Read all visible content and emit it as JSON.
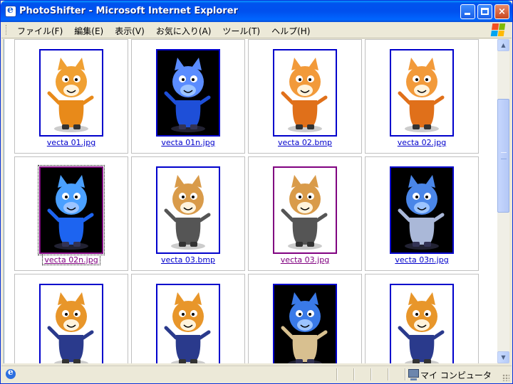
{
  "window": {
    "title": "PhotoShifter - Microsoft Internet Explorer",
    "buttons": {
      "minimize": "minimize-button",
      "maximize": "maximize-button",
      "close": "×"
    }
  },
  "menubar": {
    "items": [
      "ファイル(F)",
      "編集(E)",
      "表示(V)",
      "お気に入り(A)",
      "ツール(T)",
      "ヘルプ(H)"
    ]
  },
  "gallery": {
    "items": [
      {
        "name": "vecta 01.jpg",
        "bg": "light",
        "visited": false,
        "focus": false,
        "body": "#e88a1a",
        "skin": "#f0a032"
      },
      {
        "name": "vecta 01n.jpg",
        "bg": "dark",
        "visited": false,
        "focus": false,
        "body": "#1e4fd8",
        "skin": "#5a8cff"
      },
      {
        "name": "vecta 02.bmp",
        "bg": "light",
        "visited": false,
        "focus": false,
        "body": "#e0701a",
        "skin": "#f29a3a"
      },
      {
        "name": "vecta 02.jpg",
        "bg": "light",
        "visited": false,
        "focus": false,
        "body": "#e0701a",
        "skin": "#f29a3a"
      },
      {
        "name": "vecta 02n.jpg",
        "bg": "dark",
        "visited": true,
        "focus": true,
        "body": "#1d64f0",
        "skin": "#4aa0ff"
      },
      {
        "name": "vecta 03.bmp",
        "bg": "light",
        "visited": false,
        "focus": false,
        "body": "#555555",
        "skin": "#d99b4a"
      },
      {
        "name": "vecta 03.jpg",
        "bg": "light",
        "visited": true,
        "focus": false,
        "body": "#555555",
        "skin": "#d99b4a"
      },
      {
        "name": "vecta 03n.jpg",
        "bg": "dark",
        "visited": false,
        "focus": false,
        "body": "#aab8d8",
        "skin": "#4a86e8"
      },
      {
        "name": "",
        "bg": "light",
        "visited": false,
        "focus": false,
        "body": "#2a3a8c",
        "skin": "#e8962a"
      },
      {
        "name": "",
        "bg": "light",
        "visited": false,
        "focus": false,
        "body": "#2a3a8c",
        "skin": "#e8962a"
      },
      {
        "name": "",
        "bg": "dark",
        "visited": false,
        "focus": false,
        "body": "#d8c090",
        "skin": "#3a7ae8"
      },
      {
        "name": "",
        "bg": "light",
        "visited": false,
        "focus": false,
        "body": "#2a3a8c",
        "skin": "#e8962a"
      }
    ]
  },
  "statusbar": {
    "zone": "マイ コンピュータ"
  }
}
